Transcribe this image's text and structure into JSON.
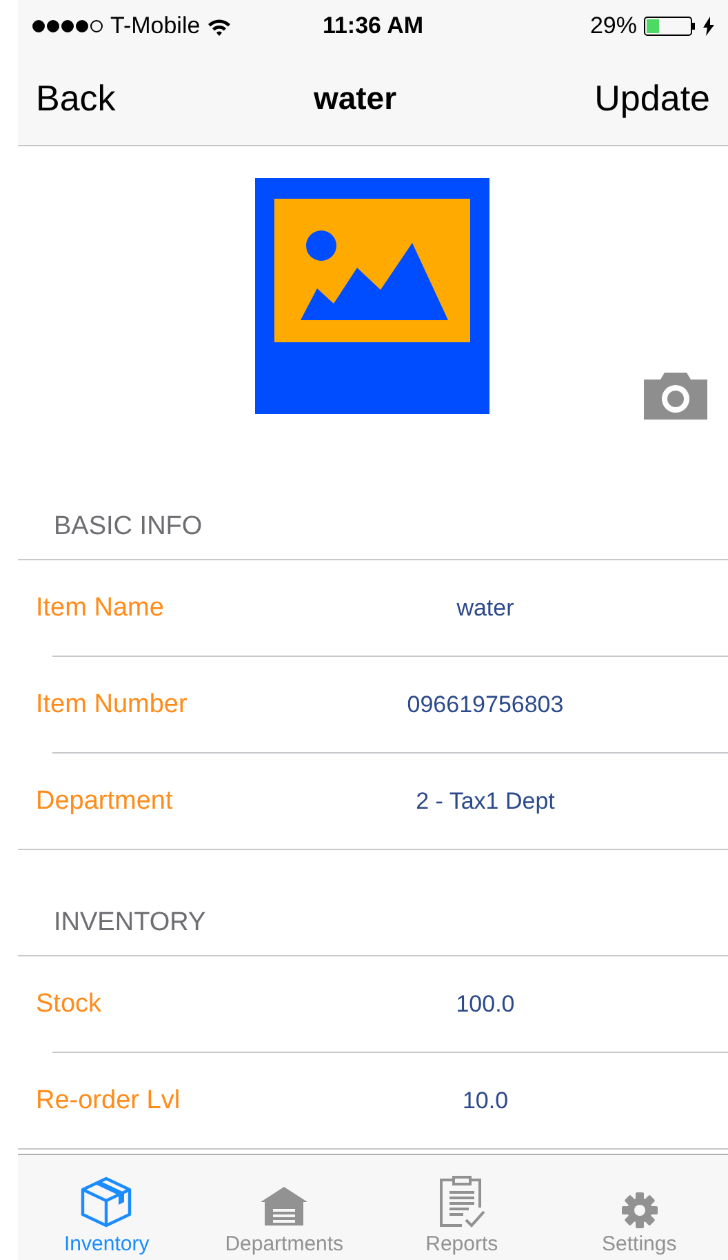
{
  "status_bar": {
    "carrier": "T-Mobile",
    "time": "11:36 AM",
    "battery": "29%"
  },
  "nav": {
    "back": "Back",
    "title": "water",
    "action": "Update"
  },
  "sections": [
    {
      "header": "BASIC INFO",
      "rows": [
        {
          "label": "Item Name",
          "value": "water"
        },
        {
          "label": "Item Number",
          "value": "096619756803"
        },
        {
          "label": "Department",
          "value": "2 - Tax1 Dept"
        }
      ]
    },
    {
      "header": "INVENTORY",
      "rows": [
        {
          "label": "Stock",
          "value": "100.0"
        },
        {
          "label": "Re-order Lvl",
          "value": "10.0"
        }
      ]
    }
  ],
  "tab_bar": [
    {
      "kind": "box",
      "label": "Inventory",
      "selected": true
    },
    {
      "kind": "garage",
      "label": "Departments",
      "selected": false
    },
    {
      "kind": "clipboard",
      "label": "Reports",
      "selected": false
    },
    {
      "kind": "gear",
      "label": "Settings",
      "selected": false
    }
  ]
}
